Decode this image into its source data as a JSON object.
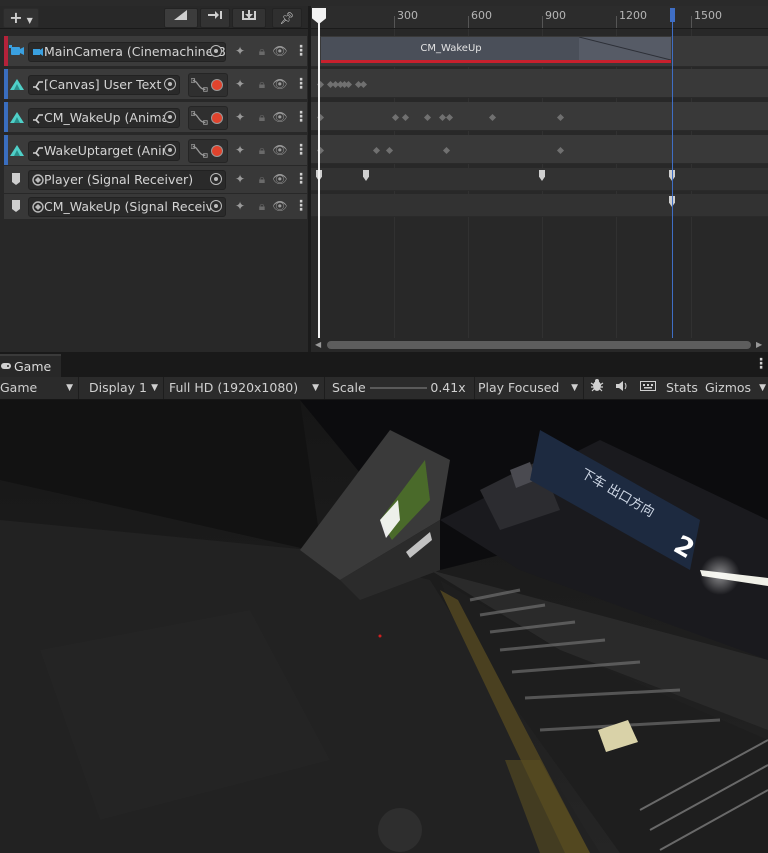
{
  "timeline": {
    "add_button": "+",
    "ruler_labels": [
      "300",
      "600",
      "900",
      "1200",
      "1500"
    ],
    "tracks": [
      {
        "name": "MainCamera (Cinemachine B",
        "color": "#b5223a",
        "kind": "cinemachine"
      },
      {
        "name": "[Canvas] User Text (/",
        "color": "#3a6ebf",
        "kind": "animation"
      },
      {
        "name": "CM_WakeUp (Animat",
        "color": "#3a6ebf",
        "kind": "animation"
      },
      {
        "name": "WakeUptarget (Anim",
        "color": "#3a6ebf",
        "kind": "animation"
      },
      {
        "name": "Player (Signal Receiver)",
        "color": "#cfcfcf",
        "kind": "signal"
      },
      {
        "name": "CM_WakeUp (Signal Receive",
        "color": "#cfcfcf",
        "kind": "signal"
      }
    ],
    "clip_label": "CM_WakeUp",
    "colors": {
      "playhead": "#f2f2f2",
      "end_marker": "#3f6ec4",
      "clip_underline": "#c8202d"
    }
  },
  "game": {
    "tab_label": "Game",
    "toolbar": {
      "view_mode": "Game",
      "display": "Display 1",
      "resolution": "Full HD (1920x1080)",
      "scale_label": "Scale",
      "scale_value": "0.41x",
      "play_mode": "Play Focused",
      "stats": "Stats",
      "gizmos": "Gizmos"
    },
    "scene_sign": {
      "line1": "下车 出口方向",
      "number": "2"
    }
  }
}
